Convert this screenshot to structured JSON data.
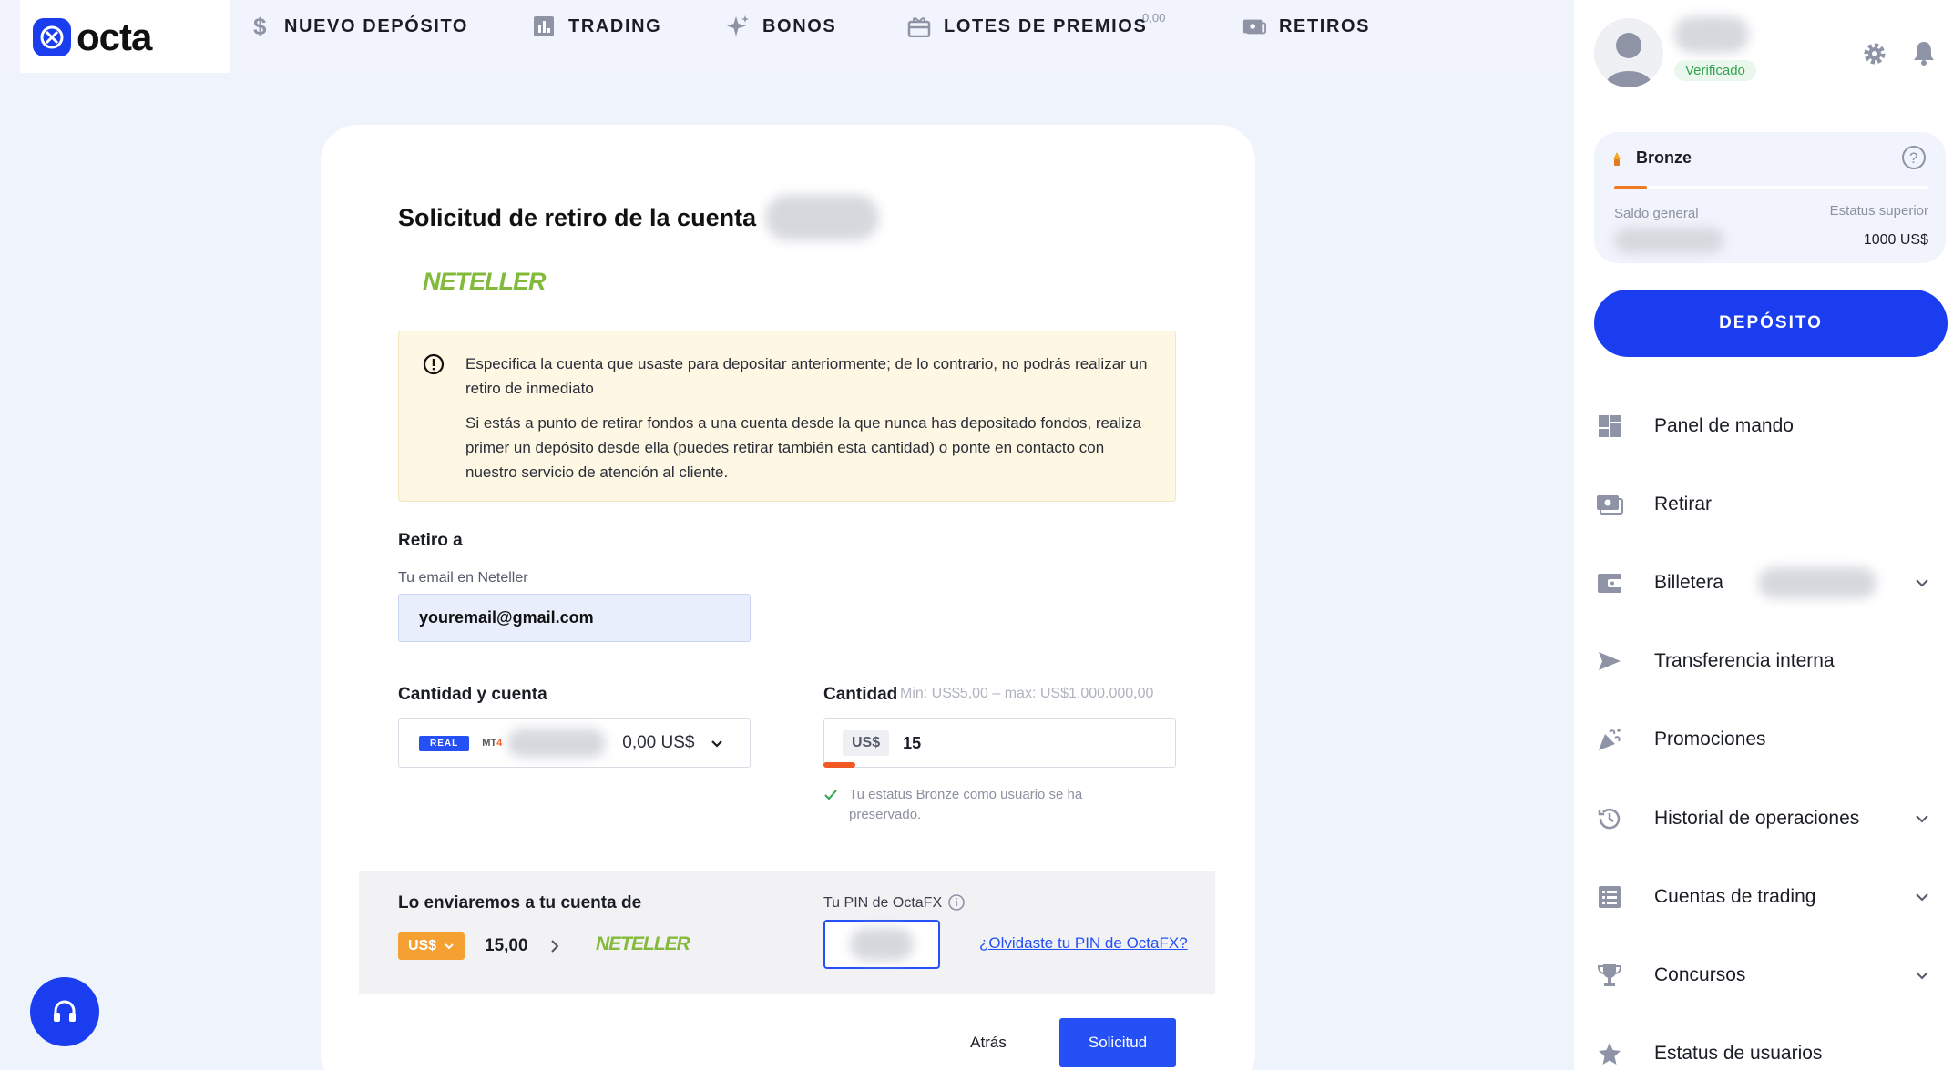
{
  "brand": {
    "name": "octa",
    "accent": "#1a3df0"
  },
  "nav": [
    {
      "label": "NUEVO DEPÓSITO",
      "icon": "dollar-icon"
    },
    {
      "label": "TRADING",
      "icon": "chart-icon"
    },
    {
      "label": "BONOS",
      "icon": "sparkle-icon"
    },
    {
      "label": "LOTES DE PREMIOS",
      "icon": "gift-icon",
      "badge": "0,00"
    },
    {
      "label": "RETIROS",
      "icon": "wallet-icon"
    }
  ],
  "form": {
    "title": "Solicitud de retiro de la cuenta",
    "method": "NETELLER",
    "warning": [
      "Especifica la cuenta que usaste para depositar anteriormente; de lo contrario, no podrás realizar un retiro de inmediato",
      "Si estás a punto de retirar fondos a una cuenta desde la que nunca has depositado fondos, realiza primer un depósito desde ella (puedes retirar también esta cantidad) o ponte en contacto con nuestro servicio de atención al cliente."
    ],
    "withdraw_to_label": "Retiro a",
    "email_label": "Tu email en Neteller",
    "email_value": "youremail@gmail.com",
    "amount_account_label": "Cantidad y cuenta",
    "account_type": "REAL",
    "platform": "MT",
    "platform_num": "4",
    "account_balance": "0,00 US$",
    "amount_label": "Cantidad",
    "amount_limits": "Min: US$5,00 – max: US$1.000.000,00",
    "currency_chip": "US$",
    "amount_value": "15",
    "status_note": "Tu estatus Bronze como usuario se ha preservado.",
    "send_label": "Lo enviaremos a tu cuenta de",
    "send_currency": "US$",
    "send_amount": "15,00",
    "pin_label": "Tu PIN de OctaFX",
    "forgot_pin": "¿Olvidaste tu PIN de OctaFX?",
    "back_label": "Atrás",
    "submit_label": "Solicitud"
  },
  "sidebar": {
    "verified": "Verificado",
    "level": "Bronze",
    "balance_label": "Saldo general",
    "next_label": "Estatus superior",
    "next_value": "1000 US$",
    "level_progress": 0.1,
    "deposit_label": "DEPÓSITO",
    "items": [
      {
        "label": "Panel de mando",
        "icon": "dashboard-icon"
      },
      {
        "label": "Retirar",
        "icon": "withdraw-icon"
      },
      {
        "label": "Billetera",
        "icon": "wallet-icon"
      },
      {
        "label": "Transferencia interna",
        "icon": "send-icon"
      },
      {
        "label": "Promociones",
        "icon": "party-icon"
      },
      {
        "label": "Historial de operaciones",
        "icon": "history-icon"
      },
      {
        "label": "Cuentas de trading",
        "icon": "list-icon"
      },
      {
        "label": "Concursos",
        "icon": "trophy-icon"
      },
      {
        "label": "Estatus de usuarios",
        "icon": "star-icon"
      }
    ]
  }
}
